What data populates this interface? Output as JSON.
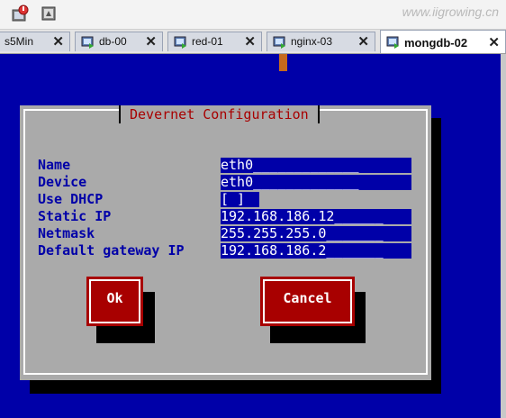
{
  "watermark": "www.iigrowing.cn",
  "toolbar": {
    "icons": [
      "vm-power-icon",
      "vm-snapshot-icon"
    ]
  },
  "tabs": [
    {
      "label": "s5Min",
      "active": false
    },
    {
      "label": "db-00",
      "active": false
    },
    {
      "label": "red-01",
      "active": false
    },
    {
      "label": "nginx-03",
      "active": false
    },
    {
      "label": "mongdb-02",
      "active": true
    }
  ],
  "tab_close_glyph": "✕",
  "dialog": {
    "title": "Devernet Configuration",
    "fields": [
      {
        "label": "Name",
        "value": "eth0_____________"
      },
      {
        "label": "Device",
        "value": "eth0_____________"
      },
      {
        "label": "Use DHCP",
        "value": "[ ]"
      },
      {
        "label": "Static IP",
        "value": "192.168.186.12______"
      },
      {
        "label": "Netmask",
        "value": "255.255.255.0_______"
      },
      {
        "label": "Default gateway IP",
        "value": "192.168.186.2_______"
      }
    ],
    "buttons": {
      "ok": "Ok",
      "cancel": "Cancel"
    }
  },
  "colors": {
    "console_bg": "#0000a8",
    "dialog_bg": "#aaaaaa",
    "title_fg": "#a80000",
    "button_bg": "#a80000"
  }
}
